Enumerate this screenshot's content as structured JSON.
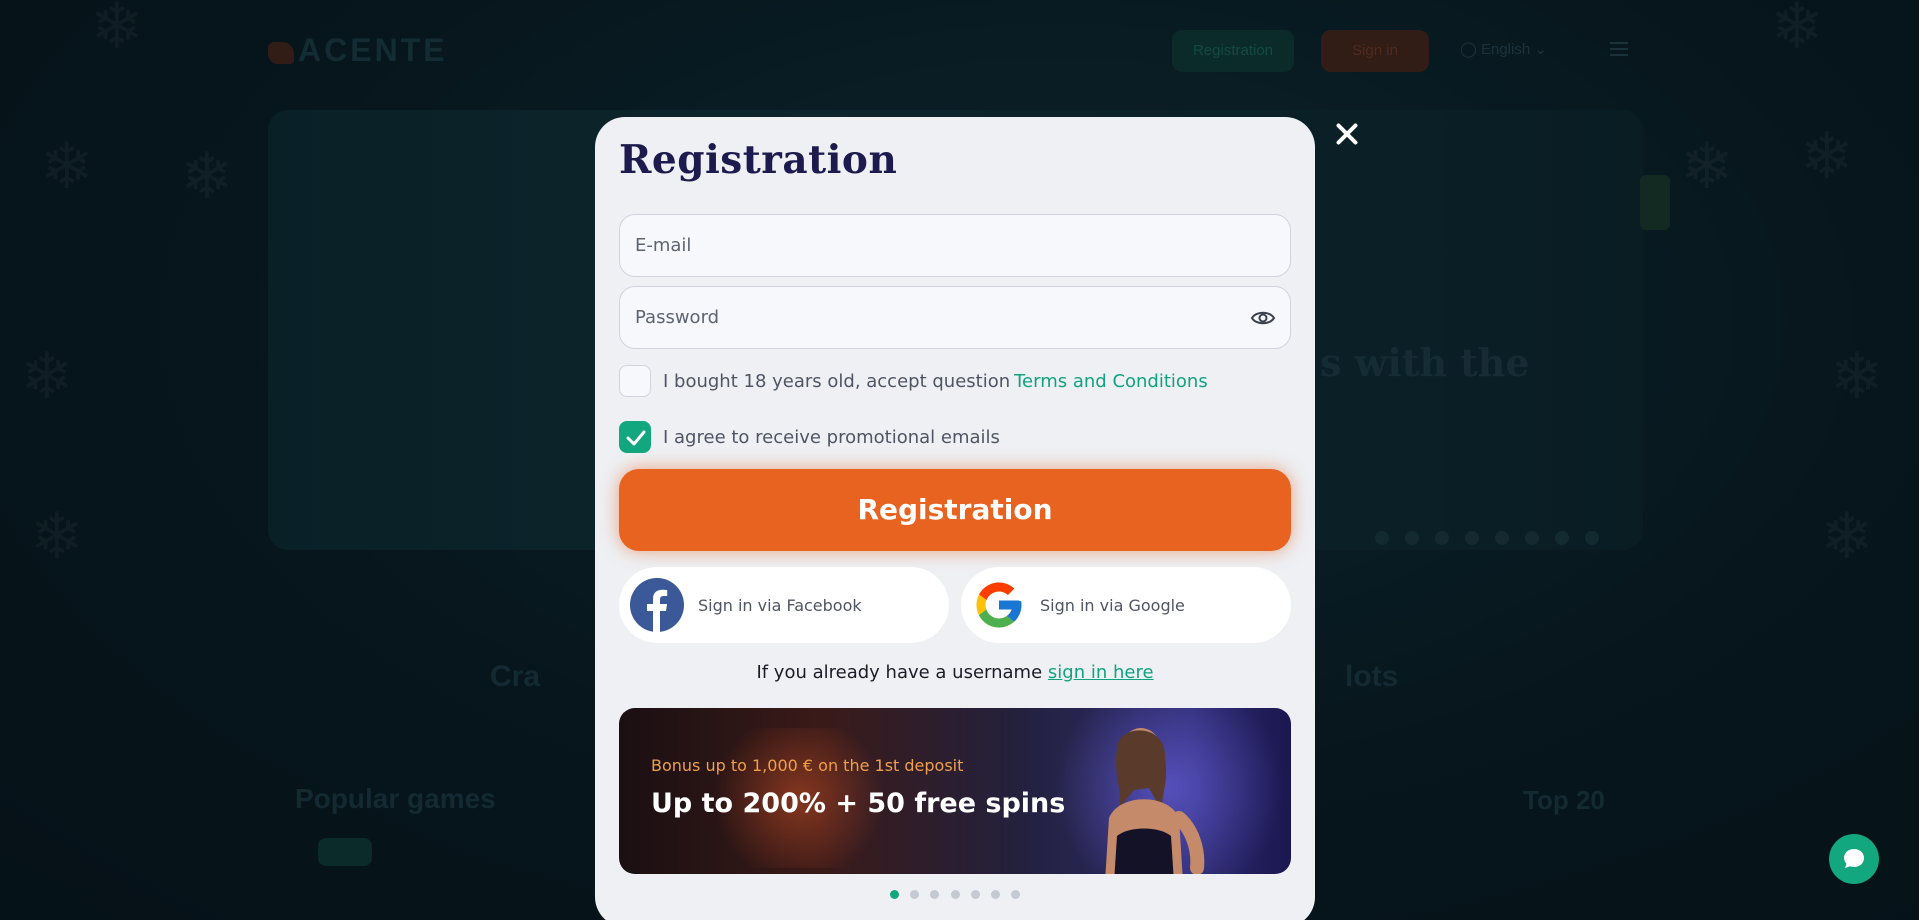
{
  "background": {
    "header": {
      "logo_text": "ACENTE",
      "registration_label": "Registration",
      "sign_in_label": "Sign in",
      "language": "English"
    },
    "hero_text": "s with the",
    "section_left": "Cra",
    "section_right": "lots",
    "popular_title": "Popular games",
    "top_label": "Top 20"
  },
  "modal": {
    "title": "Registration",
    "email": {
      "placeholder": "E-mail",
      "value": ""
    },
    "password": {
      "placeholder": "Password",
      "value": ""
    },
    "terms": {
      "checked": false,
      "text": "I bought 18 years old, accept question",
      "link": "Terms and Conditions"
    },
    "promo": {
      "checked": true,
      "text": "I agree to receive promotional emails"
    },
    "submit_label": "Registration",
    "facebook_label": "Sign in via Facebook",
    "google_label": "Sign in via Google",
    "signin_prompt": "If you already have a username",
    "signin_link": "sign in here",
    "banner": {
      "subtitle": "Bonus up to 1,000 € on the 1st deposit",
      "title": "Up to 200% + 50 free spins"
    },
    "carousel": {
      "count": 7,
      "active_index": 0
    }
  },
  "icons": {
    "close": "close-icon",
    "eye": "eye-icon",
    "check": "check-icon",
    "facebook": "facebook-icon",
    "google": "google-icon",
    "chat": "chat-icon"
  },
  "colors": {
    "accent_green": "#12a77e",
    "accent_orange": "#e8631f",
    "title_navy": "#1d1b4e",
    "modal_bg": "#eef0f4"
  }
}
